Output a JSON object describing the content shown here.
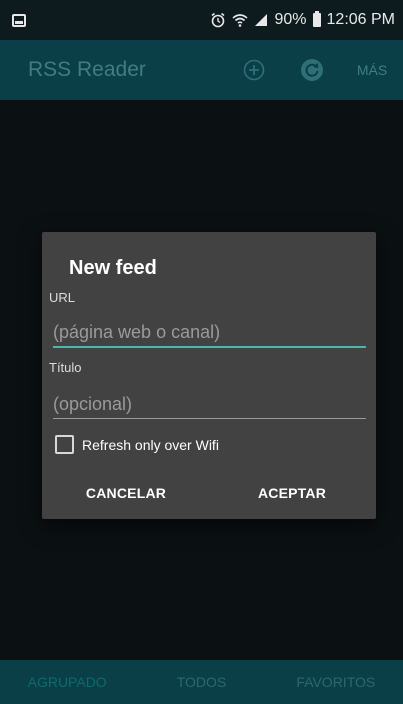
{
  "status_bar": {
    "battery": "90%",
    "time": "12:06 PM"
  },
  "app_bar": {
    "title": "RSS Reader",
    "more_label": "MÁS"
  },
  "dialog": {
    "title": "New feed",
    "url_label": "URL",
    "url_placeholder": "(página web o canal)",
    "title_label": "Título",
    "title_placeholder": "(opcional)",
    "checkbox_label": "Refresh only over Wifi",
    "checkbox_checked": false,
    "cancel_label": "CANCELAR",
    "accept_label": "ACEPTAR"
  },
  "tabs": [
    {
      "label": "AGRUPADO",
      "active": true
    },
    {
      "label": "TODOS",
      "active": false
    },
    {
      "label": "FAVORITOS",
      "active": false
    }
  ],
  "colors": {
    "app_bar": "#0a3f47",
    "accent": "#4db6ac",
    "dialog": "#424242"
  }
}
